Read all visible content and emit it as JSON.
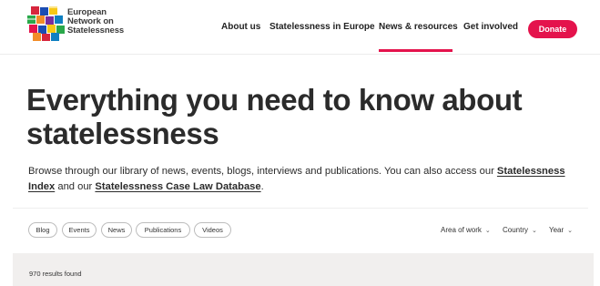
{
  "brand": {
    "name_lines": [
      "European",
      "Network on",
      "Statelessness"
    ],
    "logo_colors": [
      "#d7263d",
      "#1b4db3",
      "#f7c815",
      "#2aa84a",
      "#f28c28",
      "#7a2c9e",
      "#ffffff",
      "#e4134c",
      "#0e7fc1"
    ]
  },
  "nav": {
    "items": [
      "About us",
      "Statelessness in Europe",
      "News & resources",
      "Get involved"
    ],
    "active": "News & resources",
    "donate_label": "Donate",
    "accent": "#e4134c"
  },
  "hero": {
    "title": "Everything you need to know about statelessness",
    "intro_before": "Browse through our library of news, events, blogs, interviews and publications. You can also access our ",
    "link1": "Statelessness Index",
    "intro_middle": " and our ",
    "link2": "Statelessness Case Law Database",
    "intro_after": "."
  },
  "filters": {
    "chips": [
      "Blog",
      "Events",
      "News",
      "Publications",
      "Videos"
    ],
    "dropdowns": [
      "Area of work",
      "Country",
      "Year"
    ]
  },
  "results": {
    "count_text": "970 results found"
  }
}
